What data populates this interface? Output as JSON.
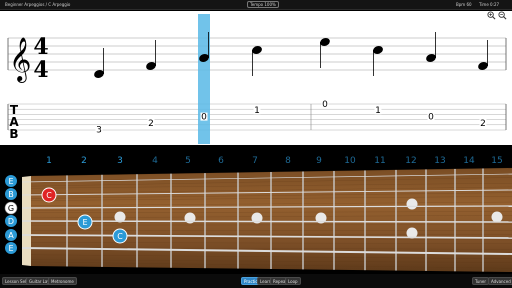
{
  "topbar": {
    "left": "Beginner Arpeggios / C Arpeggio",
    "center": "Tempo 100%",
    "mid": "Bpm 60",
    "right": "Time 0:27"
  },
  "score": {
    "time_signature": {
      "top": "4",
      "bottom": "4"
    },
    "tab_label": [
      "T",
      "A",
      "B"
    ],
    "notes": [
      {
        "tab": "3",
        "string": 5
      },
      {
        "tab": "2",
        "string": 4
      },
      {
        "tab": "0",
        "string": 3
      },
      {
        "tab": "1",
        "string": 2
      },
      {
        "tab": "0",
        "string": 1
      },
      {
        "tab": "1",
        "string": 2
      },
      {
        "tab": "0",
        "string": 3
      },
      {
        "tab": "2",
        "string": 4
      }
    ],
    "zoom_in_icon": "zoom-in-icon",
    "zoom_out_icon": "zoom-out-icon"
  },
  "fretboard": {
    "fret_numbers": [
      "1",
      "2",
      "3",
      "4",
      "5",
      "6",
      "7",
      "8",
      "9",
      "10",
      "11",
      "12",
      "13",
      "14",
      "15"
    ],
    "highlighted_frets": [
      "1",
      "2",
      "3"
    ],
    "strings": [
      "E",
      "B",
      "G",
      "D",
      "A",
      "E"
    ],
    "active_string": "G",
    "markers": [
      {
        "label": "C",
        "string": 1,
        "fret": 1,
        "color": "#e02424"
      },
      {
        "label": "E",
        "string": 3,
        "fret": 2,
        "color": "#2b9ad6"
      },
      {
        "label": "C",
        "string": 4,
        "fret": 3,
        "color": "#2b9ad6"
      }
    ],
    "inlays": [
      "3",
      "5",
      "7",
      "9",
      "12",
      "15"
    ],
    "accent_color": "#2b9ad6",
    "playhead_color": "#58b9e6"
  },
  "bottombar": {
    "left_buttons": [
      "Lesson Select",
      "Guitar Layout",
      "Metronome"
    ],
    "center_buttons": [
      "Practice",
      "Learn",
      "Repeat",
      "Loop"
    ],
    "active_center": "Practice",
    "right_buttons": [
      "Tuner",
      "Advanced"
    ]
  }
}
